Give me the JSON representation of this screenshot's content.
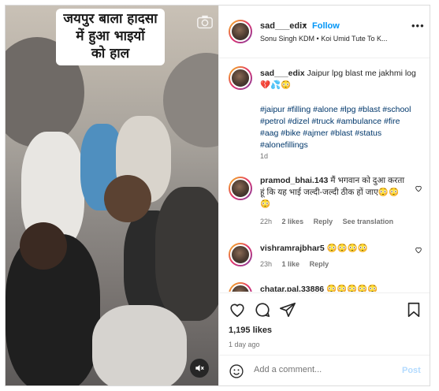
{
  "media": {
    "overlay_text": [
      "जयपुर बाला हादसा",
      "में हुआ भाइयों",
      "को हाल"
    ]
  },
  "header": {
    "username": "sad___edix",
    "dot": "•",
    "follow_label": "Follow",
    "audio": "Sonu Singh KDM • Koi Umid Tute To K...",
    "more": "•••"
  },
  "caption": {
    "username": "sad___edix",
    "text": " Jaipur lpg blast me jakhmi log 💔💦😳",
    "hashtags": "#jaipur #filling #alone #lpg #blast #school #petrol #dizel #truck #ambulance #fire #aag #bike #ajmer #blast #status #alonefillings",
    "time": "1d"
  },
  "comments": [
    {
      "username": "pramod_bhai.143",
      "text": " मैं भगवान को दुआ करता हूं कि यह भाई जल्दी-जल्दी ठीक हों जाए😳😳😳",
      "time": "22h",
      "likes": "2 likes",
      "reply": "Reply",
      "translation": "See translation"
    },
    {
      "username": "vishramrajbhar5",
      "text": " 😳😳😳😳",
      "time": "23h",
      "likes": "1 like",
      "reply": "Reply"
    },
    {
      "username": "chatar.pal.33886",
      "text": " 😳😳😳😳😳"
    }
  ],
  "actions": {
    "likes": "1,195 likes",
    "ago": "1 day ago",
    "add_comment_placeholder": "Add a comment...",
    "post_label": "Post"
  }
}
